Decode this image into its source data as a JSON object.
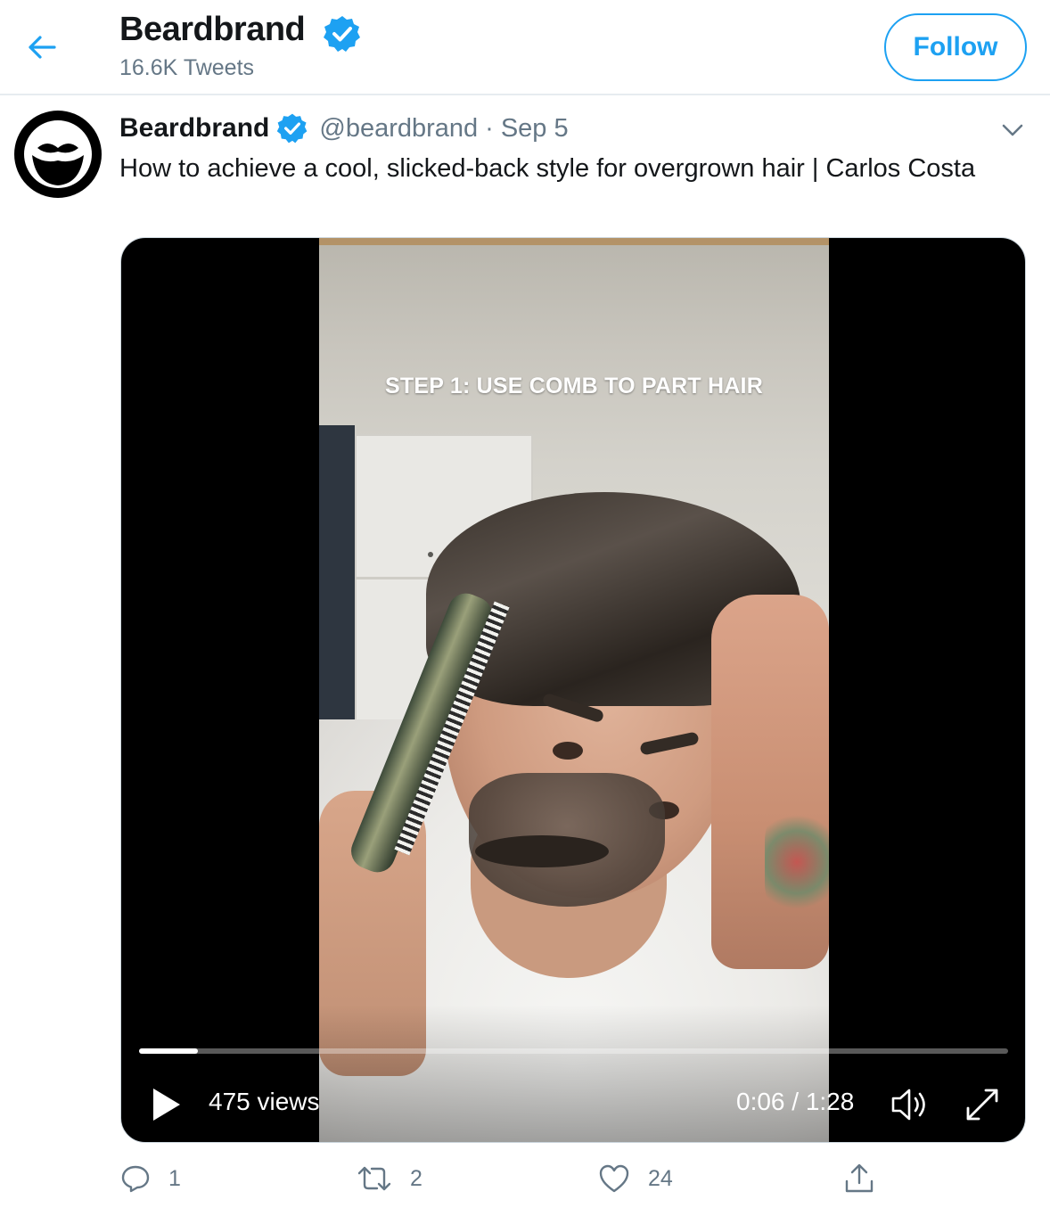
{
  "header": {
    "name": "Beardbrand",
    "tweet_count": "16.6K Tweets",
    "follow_label": "Follow"
  },
  "tweet": {
    "name": "Beardbrand",
    "handle": "@beardbrand",
    "separator": "·",
    "date": "Sep 5",
    "text": "How to achieve a cool, slicked-back style for overgrown hair | Carlos Costa"
  },
  "video": {
    "caption": "STEP 1: USE COMB TO PART HAIR",
    "views": "475 views",
    "time": "0:06 / 1:28",
    "progress": 0.068
  },
  "actions": {
    "reply_count": "1",
    "retweet_count": "2",
    "like_count": "24"
  },
  "colors": {
    "accent": "#1da1f2",
    "text_secondary": "#657786"
  },
  "icons": [
    "back-arrow-icon",
    "verified-icon",
    "chevron-down-icon",
    "play-icon",
    "volume-icon",
    "fullscreen-icon",
    "reply-icon",
    "retweet-icon",
    "like-icon",
    "share-icon"
  ]
}
